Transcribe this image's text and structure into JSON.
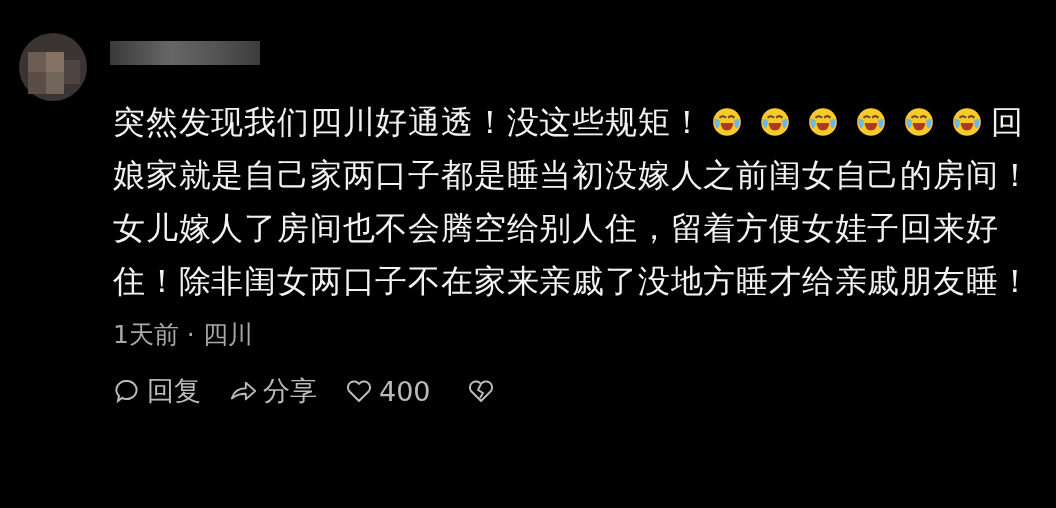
{
  "comment": {
    "segments": [
      {
        "kind": "text",
        "text": "突然发现我们四川好通透！没这些规矩！"
      },
      {
        "kind": "emoji"
      },
      {
        "kind": "emoji"
      },
      {
        "kind": "emoji"
      },
      {
        "kind": "emoji"
      },
      {
        "kind": "emoji"
      },
      {
        "kind": "emoji"
      },
      {
        "kind": "text",
        "text": "回娘家就是自己家两口子都是睡当初没嫁人之前闺女自己的房间！女儿嫁人了房间也不会腾空给别人住，留着方便女娃子回来好住！除非闺女两口子不在家来亲戚了没地方睡才给亲戚朋友睡！"
      }
    ],
    "meta": "1天前 · 四川",
    "actions": [
      {
        "kind": "reply",
        "label": "回复"
      },
      {
        "kind": "share",
        "label": "分享"
      },
      {
        "kind": "like",
        "label": "400"
      },
      {
        "kind": "dislike"
      }
    ]
  }
}
